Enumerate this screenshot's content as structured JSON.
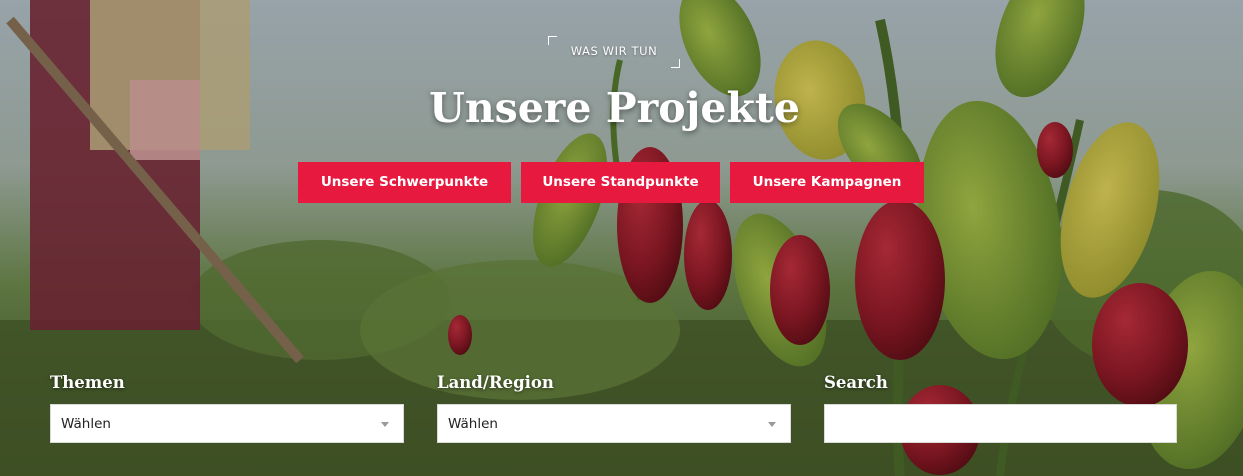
{
  "hero": {
    "eyebrow": "WAS WIR TUN",
    "title": "Unsere Projekte",
    "accent_color": "#e8193f"
  },
  "buttons": [
    {
      "label": "Unsere Schwerpunkte"
    },
    {
      "label": "Unsere Standpunkte"
    },
    {
      "label": "Unsere Kampagnen"
    }
  ],
  "filters": {
    "themen": {
      "label": "Themen",
      "selected": "Wählen"
    },
    "region": {
      "label": "Land/Region",
      "selected": "Wählen"
    },
    "search": {
      "label": "Search",
      "value": "",
      "placeholder": ""
    }
  },
  "background": {
    "icon": "chili-plants-field-photo"
  }
}
